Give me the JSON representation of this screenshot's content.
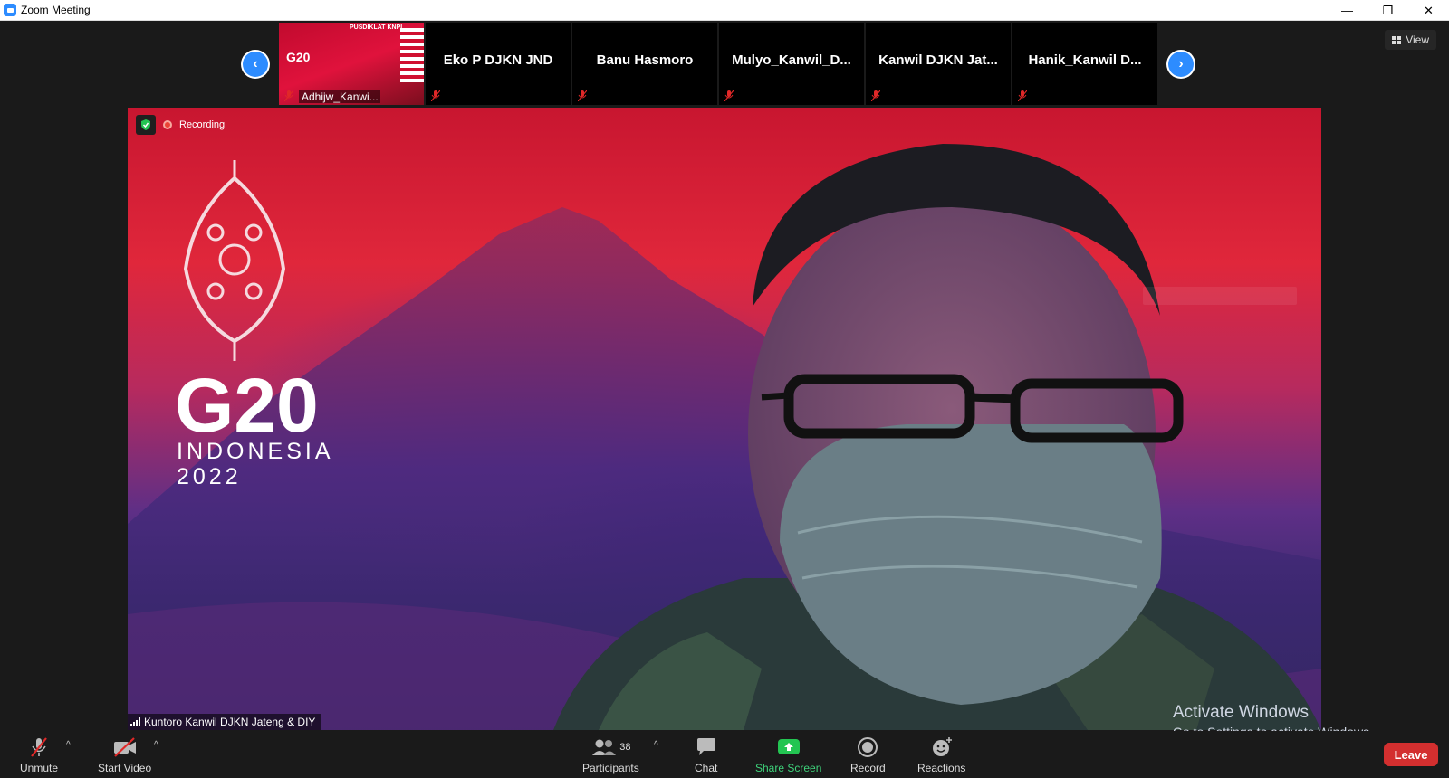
{
  "window": {
    "title": "Zoom Meeting",
    "minimize": "—",
    "restore": "❐",
    "close": "✕"
  },
  "view_button": {
    "label": "View"
  },
  "participants_strip": {
    "tiles": [
      {
        "name": "Adhijw_Kanwi...",
        "type": "video",
        "banner": "PUSDIKLAT KNPL",
        "logo_text": "G20"
      },
      {
        "name": "Eko P DJKN JND",
        "type": "name"
      },
      {
        "name": "Banu Hasmoro",
        "type": "name"
      },
      {
        "name": "Mulyo_Kanwil_D...",
        "type": "name"
      },
      {
        "name": "Kanwil DJKN Jat...",
        "type": "name"
      },
      {
        "name": "Hanik_Kanwil  D...",
        "type": "name"
      }
    ]
  },
  "recording": {
    "label": "Recording"
  },
  "main_video": {
    "speaker_name": "Kuntoro Kanwil DJKN Jateng & DIY",
    "background": {
      "line1": "G20",
      "line2": "INDONESIA",
      "line3": "2022"
    }
  },
  "activate_windows": {
    "line1": "Activate Windows",
    "line2": "Go to Settings to activate Windows."
  },
  "toolbar": {
    "unmute": "Unmute",
    "start_video": "Start Video",
    "participants": "Participants",
    "participants_count": "38",
    "chat": "Chat",
    "share_screen": "Share Screen",
    "record": "Record",
    "reactions": "Reactions",
    "leave": "Leave"
  },
  "colors": {
    "accent": "#2d8cff",
    "share_green": "#3ed27a",
    "leave_red": "#d32f2f",
    "mute_red": "#e02828"
  }
}
